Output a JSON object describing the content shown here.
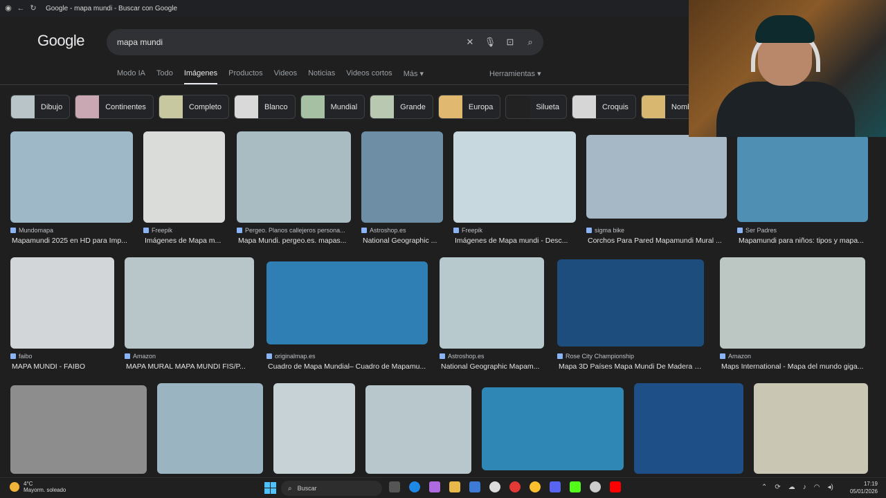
{
  "window": {
    "title": "Google - mapa mundi - Buscar con Google"
  },
  "logo": "Google",
  "search": {
    "query": "mapa mundi"
  },
  "tabs": [
    {
      "label": "Modo IA"
    },
    {
      "label": "Todo"
    },
    {
      "label": "Imágenes",
      "active": true
    },
    {
      "label": "Productos"
    },
    {
      "label": "Videos"
    },
    {
      "label": "Noticias"
    },
    {
      "label": "Videos cortos"
    },
    {
      "label": "Más ▾"
    }
  ],
  "tools_label": "Herramientas ▾",
  "chips": [
    {
      "label": "Dibujo"
    },
    {
      "label": "Continentes"
    },
    {
      "label": "Completo"
    },
    {
      "label": "Blanco"
    },
    {
      "label": "Mundial"
    },
    {
      "label": "Grande"
    },
    {
      "label": "Europa"
    },
    {
      "label": "Silueta"
    },
    {
      "label": "Croquis"
    },
    {
      "label": "Nombre"
    }
  ],
  "results": [
    {
      "source": "Mundomapa",
      "caption": "Mapamundi 2025 en HD para Imp...",
      "color": "#9fb8c8"
    },
    {
      "source": "Freepik",
      "caption": "Imágenes de Mapa m...",
      "color": "#d9dcd8"
    },
    {
      "source": "Pergeo. Planos callejeros persona...",
      "caption": "Mapa Mundi. pergeo.es. mapas...",
      "color": "#a9bcc2"
    },
    {
      "source": "Astroshop.es",
      "caption": "National Geographic ...",
      "color": "#6e8ea6"
    },
    {
      "source": "Freepik",
      "caption": "Imágenes de Mapa mundi - Desc...",
      "color": "#c7d8de"
    },
    {
      "source": "sigma bike",
      "caption": "Corchos Para Pared Mapamundi Mural ...",
      "color": "#a6b8c6"
    },
    {
      "source": "Ser Padres",
      "caption": "Mapamundi para niños: tipos y mapa...",
      "color": "#4f8fb4"
    },
    {
      "source": "faibo",
      "caption": "MAPA MUNDI - FAIBO",
      "color": "#d2d6d8"
    },
    {
      "source": "Amazon",
      "caption": "MAPA MURAL MAPA MUNDI FIS/P...",
      "color": "#b9c6c9"
    },
    {
      "source": "originalmap.es",
      "caption": "Cuadro de Mapa Mundial– Cuadro de Mapamu...",
      "color": "#2f7fb5"
    },
    {
      "source": "Astroshop.es",
      "caption": "National Geographic Mapam...",
      "color": "#b7c9cd"
    },
    {
      "source": "Rose City Championship",
      "caption": "Mapa 3D Países Mapa Mundi De Madera 3...",
      "color": "#1d4d7d"
    },
    {
      "source": "Amazon",
      "caption": "Maps International - Mapa del mundo giga...",
      "color": "#bcc7c4"
    },
    {
      "source": "",
      "caption": "",
      "color": "#8d8d8d"
    },
    {
      "source": "",
      "caption": "",
      "color": "#9ab4c2"
    },
    {
      "source": "",
      "caption": "",
      "color": "#c7d2d6"
    },
    {
      "source": "",
      "caption": "",
      "color": "#b8c7cc"
    },
    {
      "source": "",
      "caption": "",
      "color": "#2f87b5"
    },
    {
      "source": "",
      "caption": "",
      "color": "#1e4f86"
    },
    {
      "source": "",
      "caption": "",
      "color": "#c9c6b4"
    }
  ],
  "taskbar": {
    "temp": "4°C",
    "weather": "Mayorm. soleado",
    "search_label": "Buscar",
    "time": "17:19",
    "date": "05/01/2026"
  }
}
